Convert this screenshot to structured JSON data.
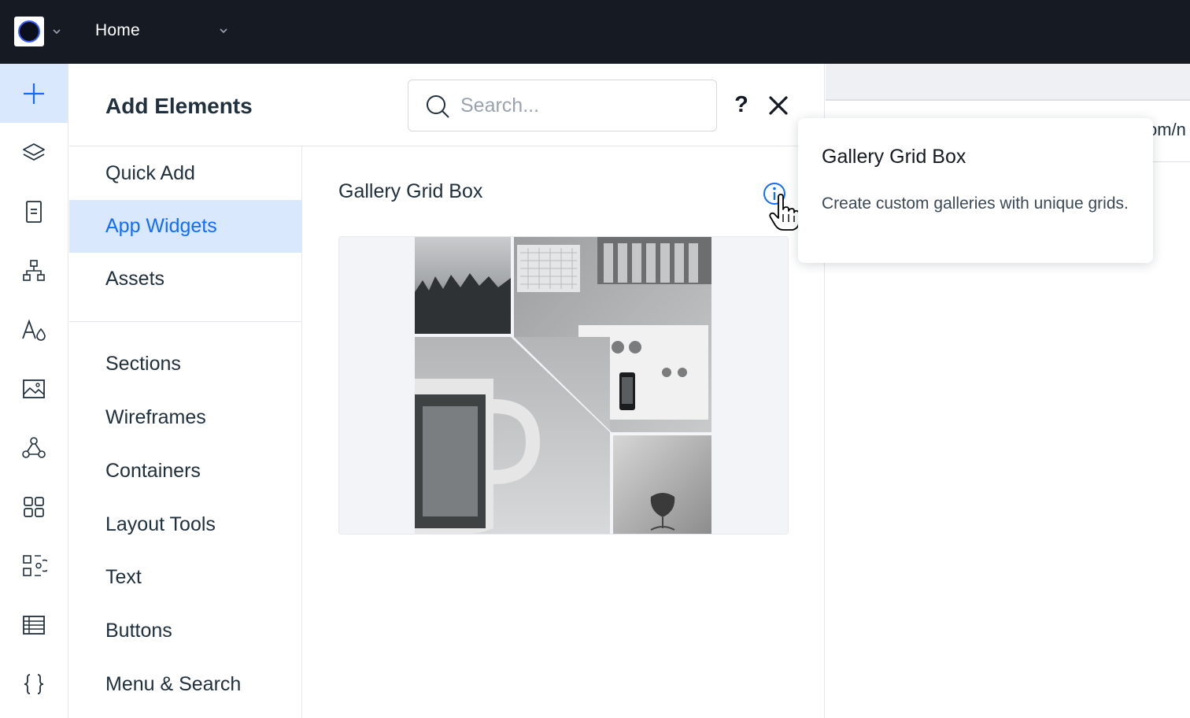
{
  "topbar": {
    "page_selector_label": "Home",
    "logo_icon": "site-logo-icon",
    "colors": {
      "background": "#151a23",
      "text": "#ffffff"
    }
  },
  "rail": {
    "items": [
      {
        "icon": "add-plus-icon",
        "active": true
      },
      {
        "icon": "layers-icon",
        "active": false
      },
      {
        "icon": "pages-icon",
        "active": false
      },
      {
        "icon": "site-structure-icon",
        "active": false
      },
      {
        "icon": "theme-text-icon",
        "active": false
      },
      {
        "icon": "media-image-icon",
        "active": false
      },
      {
        "icon": "apps-integrations-icon",
        "active": false
      },
      {
        "icon": "app-market-grid-icon",
        "active": false
      },
      {
        "icon": "business-apps-icon",
        "active": false
      },
      {
        "icon": "cms-table-icon",
        "active": false
      },
      {
        "icon": "code-braces-icon",
        "active": false
      }
    ]
  },
  "panel": {
    "title": "Add Elements",
    "search": {
      "placeholder": "Search...",
      "value": ""
    },
    "help_label": "?",
    "categories_top": [
      {
        "label": "Quick Add",
        "active": false
      },
      {
        "label": "App Widgets",
        "active": true
      },
      {
        "label": "Assets",
        "active": false
      }
    ],
    "categories_bottom": [
      {
        "label": "Sections"
      },
      {
        "label": "Wireframes"
      },
      {
        "label": "Containers"
      },
      {
        "label": "Layout Tools"
      },
      {
        "label": "Text"
      },
      {
        "label": "Buttons"
      },
      {
        "label": "Menu & Search"
      }
    ],
    "widget": {
      "title": "Gallery Grid Box",
      "info_icon": "info-icon"
    }
  },
  "canvas": {
    "url_fragment": "om/n"
  },
  "tooltip": {
    "title": "Gallery Grid Box",
    "description": "Create custom galleries with unique grids."
  },
  "colors": {
    "accent": "#116dff",
    "active_bg": "#d9e8fd",
    "text": "#20303c",
    "border": "#e3e6ea"
  }
}
